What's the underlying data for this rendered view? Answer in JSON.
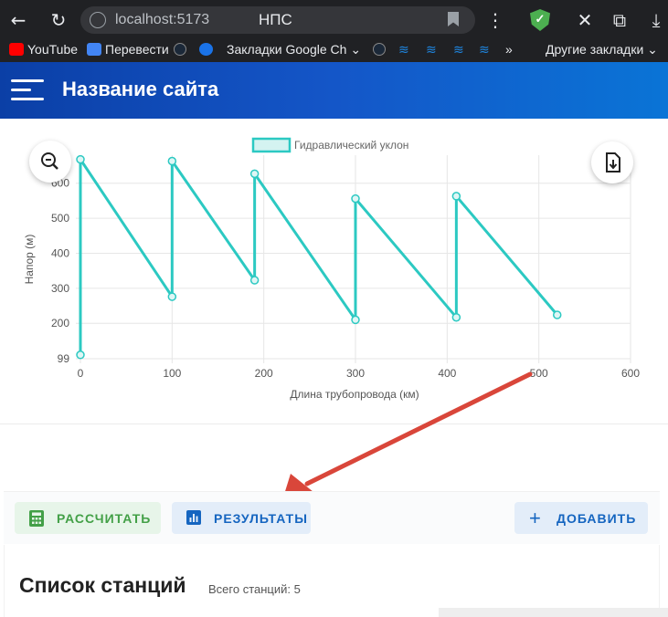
{
  "browser": {
    "url": "localhost:5173",
    "tab_title": "НПС",
    "bookmarks": [
      {
        "label": "YouTube",
        "icon": "youtube-icon"
      },
      {
        "label": "Перевести",
        "icon": "translate-icon"
      },
      {
        "label": "",
        "icon": "steam-icon"
      },
      {
        "label": "",
        "icon": "at-icon"
      },
      {
        "label": "Закладки Google Ch",
        "icon": "folder-icon"
      },
      {
        "label": "Другие закладки",
        "icon": "folder-icon"
      }
    ],
    "more_bookmarks": "»"
  },
  "header": {
    "title": "Название сайта"
  },
  "chart_data": {
    "type": "line",
    "legend": "Гидравлический уклон",
    "legend_position": "top",
    "xlabel": "Длина трубопровода (км)",
    "ylabel": "Напор (м)",
    "xlim": [
      0,
      600
    ],
    "ylim": [
      99,
      680
    ],
    "x_ticks": [
      0,
      100,
      200,
      300,
      400,
      500,
      600
    ],
    "y_ticks": [
      99,
      200,
      300,
      400,
      500,
      600
    ],
    "grid": true,
    "color": "#2cc9c2",
    "series": [
      {
        "name": "Гидравлический уклон",
        "points": [
          [
            0,
            110
          ],
          [
            0,
            668
          ],
          [
            100,
            276
          ],
          [
            100,
            663
          ],
          [
            190,
            323
          ],
          [
            190,
            627
          ],
          [
            300,
            210
          ],
          [
            300,
            556
          ],
          [
            410,
            217
          ],
          [
            410,
            563
          ],
          [
            520,
            224
          ]
        ]
      }
    ]
  },
  "actions": {
    "calculate": "РАССЧИТАТЬ",
    "results": "РЕЗУЛЬТАТЫ",
    "add": "ДОБАВИТЬ"
  },
  "station_list": {
    "title": "Список станций",
    "count": "Всего станций: 5"
  },
  "colors": {
    "accent": "#1456c8",
    "line": "#2cc9c2",
    "calc": "#43a047",
    "results": "#1565c0"
  }
}
